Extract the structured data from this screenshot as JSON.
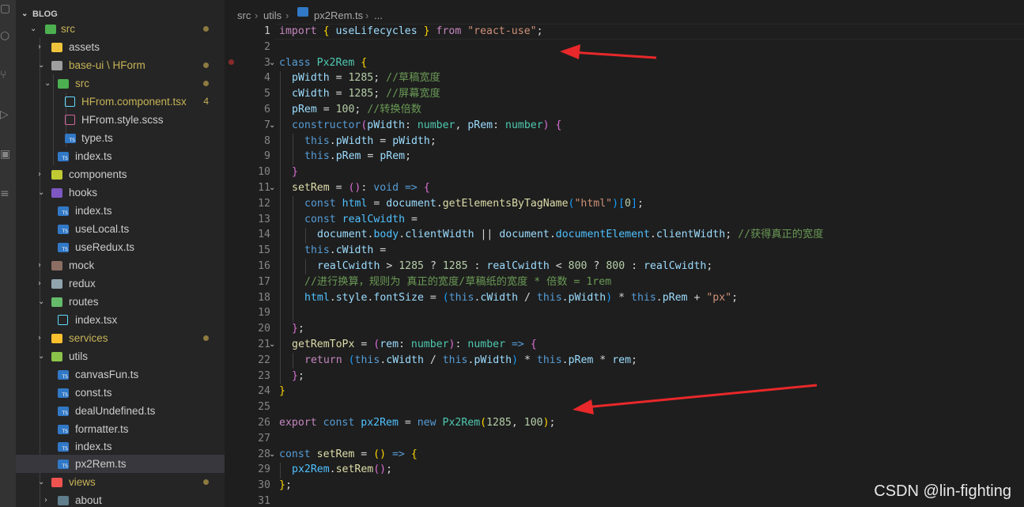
{
  "explorer": {
    "title": "BLOG",
    "items": [
      {
        "label": "src",
        "badge": ""
      },
      {
        "label": "assets",
        "badge": ""
      },
      {
        "label": "base-ui \\ HForm",
        "badge": ""
      },
      {
        "label": "src",
        "badge": ""
      },
      {
        "label": "HFrom.component.tsx",
        "badge": "4"
      },
      {
        "label": "HFrom.style.scss",
        "badge": ""
      },
      {
        "label": "type.ts",
        "badge": ""
      },
      {
        "label": "index.ts",
        "badge": ""
      },
      {
        "label": "components",
        "badge": ""
      },
      {
        "label": "hooks",
        "badge": ""
      },
      {
        "label": "index.ts",
        "badge": ""
      },
      {
        "label": "useLocal.ts",
        "badge": ""
      },
      {
        "label": "useRedux.ts",
        "badge": ""
      },
      {
        "label": "mock",
        "badge": ""
      },
      {
        "label": "redux",
        "badge": ""
      },
      {
        "label": "routes",
        "badge": ""
      },
      {
        "label": "index.tsx",
        "badge": ""
      },
      {
        "label": "services",
        "badge": ""
      },
      {
        "label": "utils",
        "badge": ""
      },
      {
        "label": "canvasFun.ts",
        "badge": ""
      },
      {
        "label": "const.ts",
        "badge": ""
      },
      {
        "label": "dealUndefined.ts",
        "badge": ""
      },
      {
        "label": "formatter.ts",
        "badge": ""
      },
      {
        "label": "index.ts",
        "badge": ""
      },
      {
        "label": "px2Rem.ts",
        "badge": ""
      },
      {
        "label": "views",
        "badge": ""
      },
      {
        "label": "about",
        "badge": ""
      }
    ]
  },
  "breadcrumb": {
    "parts": [
      "src",
      "utils",
      "px2Rem.ts",
      "..."
    ]
  },
  "line_numbers": [
    "1",
    "2",
    "3",
    "4",
    "5",
    "6",
    "7",
    "8",
    "9",
    "10",
    "11",
    "12",
    "13",
    "14",
    "15",
    "16",
    "17",
    "18",
    "19",
    "20",
    "21",
    "22",
    "23",
    "24",
    "25",
    "26",
    "27",
    "28",
    "29",
    "30",
    "31"
  ],
  "code": {
    "l1": [
      "import",
      " { ",
      "useLifecycles",
      " } ",
      "from",
      " ",
      "\"react-use\"",
      ";"
    ],
    "l3": [
      "class",
      " ",
      "Px2Rem",
      " ",
      "{"
    ],
    "l4": [
      "pWidth",
      " = ",
      "1285",
      "; ",
      "//草稿宽度"
    ],
    "l5": [
      "cWidth",
      " = ",
      "1285",
      "; ",
      "//屏幕宽度"
    ],
    "l6": [
      "pRem",
      " = ",
      "100",
      "; ",
      "//转换倍数"
    ],
    "l7": [
      "constructor",
      "(",
      "pWidth",
      ": ",
      "number",
      ", ",
      "pRem",
      ": ",
      "number",
      ") ",
      "{"
    ],
    "l8": [
      "this",
      ".",
      "pWidth",
      " = ",
      "pWidth",
      ";"
    ],
    "l9": [
      "this",
      ".",
      "pRem",
      " = ",
      "pRem",
      ";"
    ],
    "l10": [
      "}"
    ],
    "l11": [
      "setRem",
      " = ",
      "()",
      ": ",
      "void",
      " ",
      "=>",
      " ",
      "{"
    ],
    "l12": [
      "const",
      " ",
      "html",
      " = ",
      "document",
      ".",
      "getElementsByTagName",
      "(",
      "\"html\"",
      ")",
      "[",
      "0",
      "]",
      ";"
    ],
    "l13": [
      "const",
      " ",
      "realCwidth",
      " ="
    ],
    "l14": [
      "document",
      ".",
      "body",
      ".",
      "clientWidth",
      " || ",
      "document",
      ".",
      "documentElement",
      ".",
      "clientWidth",
      "; ",
      "//获得真正的宽度"
    ],
    "l15": [
      "this",
      ".",
      "cWidth",
      " ="
    ],
    "l16": [
      "realCwidth",
      " > ",
      "1285",
      " ? ",
      "1285",
      " : ",
      "realCwidth",
      " < ",
      "800",
      " ? ",
      "800",
      " : ",
      "realCwidth",
      ";"
    ],
    "l17": [
      "//进行换算，规则为 真正的宽度/草稿纸的宽度 * 倍数 = 1rem"
    ],
    "l18": [
      "html",
      ".",
      "style",
      ".",
      "fontSize",
      " = ",
      "(",
      "this",
      ".",
      "cWidth",
      " / ",
      "this",
      ".",
      "pWidth",
      ")",
      " * ",
      "this",
      ".",
      "pRem",
      " + ",
      "\"px\"",
      ";"
    ],
    "l20": [
      "}",
      ";"
    ],
    "l21": [
      "getRemToPx",
      " = ",
      "(",
      "rem",
      ": ",
      "number",
      ")",
      ": ",
      "number",
      " ",
      "=>",
      " ",
      "{"
    ],
    "l22": [
      "return",
      " ",
      "(",
      "this",
      ".",
      "cWidth",
      " / ",
      "this",
      ".",
      "pWidth",
      ")",
      " * ",
      "this",
      ".",
      "pRem",
      " * ",
      "rem",
      ";"
    ],
    "l23": [
      "}",
      ";"
    ],
    "l24": [
      "}"
    ],
    "l26": [
      "export",
      " ",
      "const",
      " ",
      "px2Rem",
      " = ",
      "new",
      " ",
      "Px2Rem",
      "(",
      "1285",
      ", ",
      "100",
      ")",
      ";"
    ],
    "l28": [
      "const",
      " ",
      "setRem",
      " = ",
      "()",
      " ",
      "=>",
      " ",
      "{"
    ],
    "l29": [
      "px2Rem",
      ".",
      "setRem",
      "()",
      ";"
    ],
    "l30": [
      "}",
      ";"
    ]
  },
  "watermark": "CSDN @lin-fighting",
  "colors": {
    "keyword": "#569cd6",
    "control": "#c586c0",
    "string": "#ce9178",
    "comment": "#6a9955",
    "number": "#b5cea8",
    "variable": "#9cdcfe",
    "type": "#4ec9b0",
    "function": "#dcdcaa",
    "annotation_arrow": "#e8282a"
  },
  "icons": {
    "activity": [
      "files-icon",
      "search-icon",
      "source-control-icon",
      "run-icon",
      "extensions-icon",
      "list-icon"
    ]
  }
}
